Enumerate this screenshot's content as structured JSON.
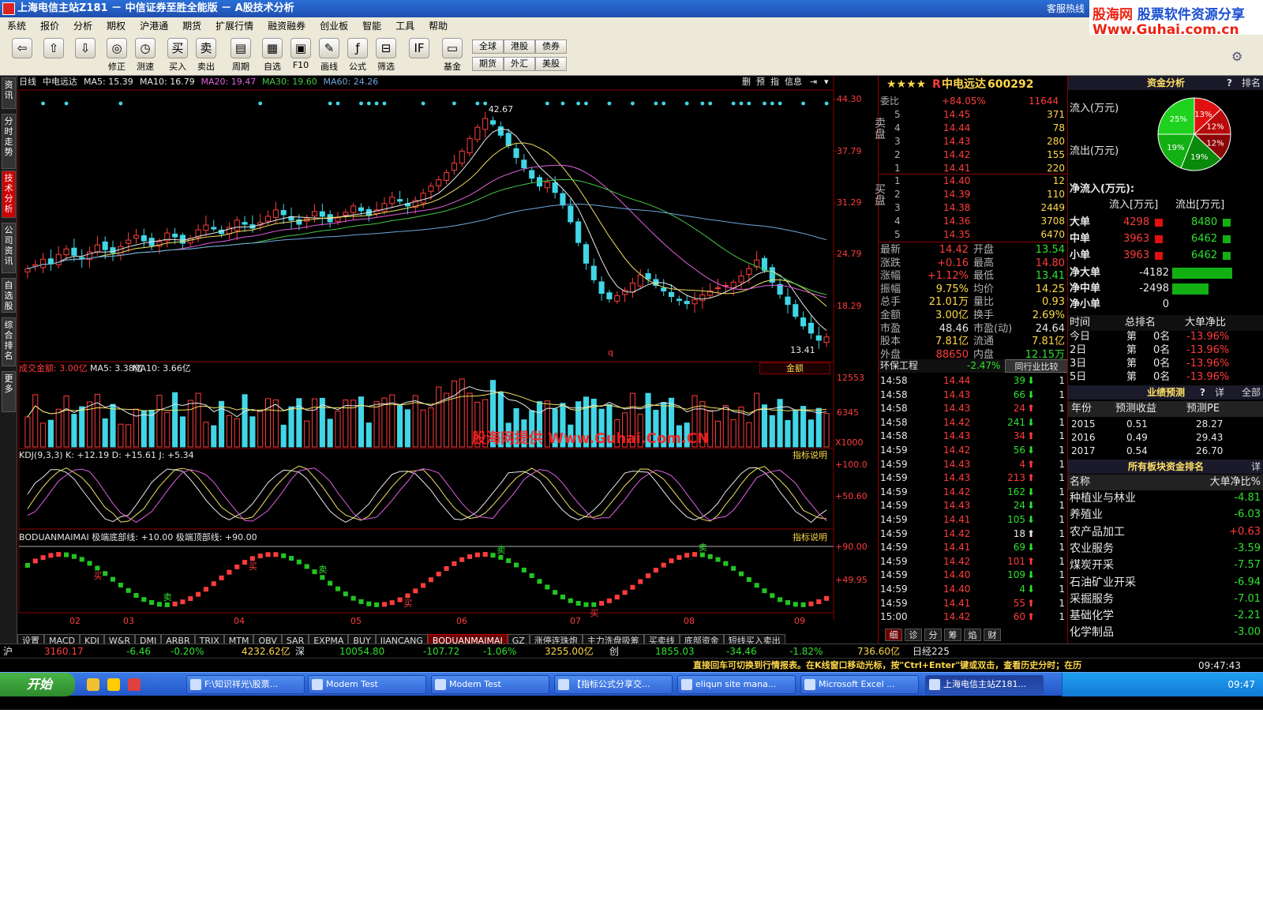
{
  "window": {
    "title": "上海电信主站Z181 － 中信证券至胜全能版 － A股技术分析",
    "hotline": "客服热线",
    "watermark": {
      "line1_blue": "股海网",
      "line1_rest": "股票软件资源分享",
      "line2": "Www.Guhai.com.cn"
    }
  },
  "menu": [
    "系统",
    "报价",
    "分析",
    "期权",
    "沪港通",
    "期货",
    "扩展行情",
    "融资融券",
    "创业板",
    "智能",
    "工具",
    "帮助"
  ],
  "toolbar": {
    "buttons": [
      {
        "label": "",
        "icon": "arrow-left-icon",
        "glyph": "⇦"
      },
      {
        "label": "",
        "icon": "arrow-up-icon",
        "glyph": "⇧"
      },
      {
        "label": "",
        "icon": "arrow-down-icon",
        "glyph": "⇩"
      },
      {
        "label": "修正",
        "icon": "fix-icon",
        "glyph": "◎"
      },
      {
        "label": "测速",
        "icon": "clock-icon",
        "glyph": "◷"
      },
      {
        "label": "买入",
        "icon": "buy-icon",
        "glyph": "买"
      },
      {
        "label": "卖出",
        "icon": "sell-icon",
        "glyph": "卖"
      },
      {
        "label": "周期",
        "icon": "period-icon",
        "glyph": "▤"
      },
      {
        "label": "自选",
        "icon": "watchlist-icon",
        "glyph": "▦"
      },
      {
        "label": "F10",
        "icon": "f10-icon",
        "glyph": "▣"
      },
      {
        "label": "画线",
        "icon": "draw-icon",
        "glyph": "✎"
      },
      {
        "label": "公式",
        "icon": "formula-icon",
        "glyph": "ƒ"
      },
      {
        "label": "筛选",
        "icon": "filter-icon",
        "glyph": "⊟"
      },
      {
        "label": "",
        "icon": "if-icon",
        "glyph": "IF"
      },
      {
        "label": "基金",
        "icon": "fund-icon",
        "glyph": "▭"
      }
    ],
    "small": [
      "全球",
      "港股",
      "债券",
      "期货",
      "外汇",
      "美股"
    ]
  },
  "left_tabs": [
    {
      "label": "资讯"
    },
    {
      "label": "分时走势"
    },
    {
      "label": "技术分析",
      "active": true
    },
    {
      "label": "公司资讯"
    },
    {
      "label": "自选股"
    },
    {
      "label": "综合排名"
    },
    {
      "label": "更多"
    }
  ],
  "kline": {
    "period": "日线",
    "name": "中电远达",
    "ma": [
      {
        "label": "MA5: 15.39",
        "color": "#e8e8e8"
      },
      {
        "label": "MA10: 16.79",
        "color": "#e8e8e8"
      },
      {
        "label": "MA20: 19.47",
        "color": "#e060e0"
      },
      {
        "label": "MA30: 19.60",
        "color": "#46c646"
      },
      {
        "label": "MA60: 24.26",
        "color": "#6fa8dc"
      }
    ],
    "top_buttons": [
      "删",
      "预",
      "指",
      "信息"
    ],
    "y_labels": [
      "44.30",
      "37.79",
      "31.29",
      "24.79",
      "18.29"
    ],
    "high_label": "42.67",
    "low_label": "13.41",
    "x_labels": [
      "02",
      "03",
      "04",
      "05",
      "06",
      "07",
      "08",
      "09"
    ],
    "q_marker": "q",
    "close": [
      23.0,
      23.5,
      24.2,
      23.6,
      24.8,
      25.5,
      24.7,
      24.3,
      25.1,
      26.0,
      25.4,
      25.0,
      25.8,
      26.6,
      27.2,
      26.5,
      25.9,
      26.4,
      27.5,
      27.0,
      26.2,
      26.8,
      27.9,
      28.5,
      28.0,
      27.4,
      28.2,
      29.1,
      28.6,
      28.1,
      28.8,
      29.6,
      30.4,
      29.8,
      29.1,
      28.6,
      29.3,
      30.2,
      29.6,
      28.9,
      29.4,
      30.1,
      30.9,
      30.3,
      29.7,
      30.4,
      31.2,
      32.0,
      31.5,
      30.9,
      31.6,
      32.5,
      33.4,
      34.2,
      35.1,
      36.3,
      37.8,
      39.4,
      40.8,
      41.9,
      41.2,
      39.8,
      38.5,
      37.0,
      35.7,
      34.4,
      33.4,
      33.9,
      32.6,
      31.0,
      28.9,
      26.3,
      23.7,
      21.6,
      19.9,
      19.2,
      19.6,
      20.3,
      21.2,
      22.2,
      21.7,
      20.9,
      20.2,
      19.5,
      19.0,
      18.6,
      19.1,
      19.7,
      20.2,
      20.6,
      20.9,
      21.3,
      22.1,
      23.0,
      24.1,
      22.8,
      21.3,
      19.8,
      18.5,
      17.0,
      15.8,
      14.9,
      14.0,
      14.42
    ],
    "sub1": {
      "title": "成交金额: 3.00亿",
      "ma": [
        "MA5: 3.38亿",
        "MA10: 3.66亿"
      ],
      "dropdown": "金额",
      "y_labels": [
        "12553",
        "6345"
      ],
      "unit": "X1000",
      "watermark": "股海网提供 Www.Guhai.Com.CN"
    },
    "sub2": {
      "title": "KDJ(9,3,3) K: +12.19 D: +15.61 J: +5.34",
      "help": "指标说明",
      "y_labels": [
        "+100.0",
        "+50.60"
      ]
    },
    "sub3": {
      "title": "BODUANMAIMAI 极端底部线: +10.00 极端顶部线: +90.00",
      "help": "指标说明",
      "y_labels": [
        "+90.00",
        "+49.95"
      ],
      "buy": "买",
      "sell": "卖"
    }
  },
  "bottom_tabs": [
    {
      "label": "设置"
    },
    {
      "label": "MACD"
    },
    {
      "label": "KDJ"
    },
    {
      "label": "W&R"
    },
    {
      "label": "DMI"
    },
    {
      "label": "ARBR"
    },
    {
      "label": "TRIX"
    },
    {
      "label": "MTM"
    },
    {
      "label": "OBV"
    },
    {
      "label": "SAR"
    },
    {
      "label": "EXPMA"
    },
    {
      "label": "BUY"
    },
    {
      "label": "JIANCANG"
    },
    {
      "label": "BODUANMAIMAI",
      "active": true
    },
    {
      "label": "GZ"
    },
    {
      "label": "涨停连珠炮"
    },
    {
      "label": "主力洗盘吸筹"
    },
    {
      "label": "买卖线"
    },
    {
      "label": "底部资金"
    },
    {
      "label": "短线买入卖出"
    }
  ],
  "quote": {
    "stars": "★★★★",
    "r_badge": "R",
    "name": "中电远达",
    "code": "600292",
    "weibi_label": "委比",
    "weibi": "+84.05%",
    "weicha": "11644",
    "sell_label": "卖盘",
    "buy_label": "买盘",
    "asks": [
      {
        "n": "5",
        "p": "14.45",
        "v": "371"
      },
      {
        "n": "4",
        "p": "14.44",
        "v": "78"
      },
      {
        "n": "3",
        "p": "14.43",
        "v": "280"
      },
      {
        "n": "2",
        "p": "14.42",
        "v": "155"
      },
      {
        "n": "1",
        "p": "14.41",
        "v": "220"
      }
    ],
    "bids": [
      {
        "n": "1",
        "p": "14.40",
        "v": "12"
      },
      {
        "n": "2",
        "p": "14.39",
        "v": "110"
      },
      {
        "n": "3",
        "p": "14.38",
        "v": "2449"
      },
      {
        "n": "4",
        "p": "14.36",
        "v": "3708"
      },
      {
        "n": "5",
        "p": "14.35",
        "v": "6470"
      }
    ],
    "stats": [
      {
        "l1": "最新",
        "v1": "14.42",
        "c1": "red",
        "l2": "开盘",
        "v2": "13.54",
        "c2": "grn"
      },
      {
        "l1": "涨跌",
        "v1": "+0.16",
        "c1": "red",
        "l2": "最高",
        "v2": "14.80",
        "c2": "red"
      },
      {
        "l1": "涨幅",
        "v1": "+1.12%",
        "c1": "red",
        "l2": "最低",
        "v2": "13.41",
        "c2": "grn"
      },
      {
        "l1": "振幅",
        "v1": "9.75%",
        "c1": "yel",
        "l2": "均价",
        "v2": "14.25",
        "c2": "yel"
      },
      {
        "l1": "总手",
        "v1": "21.01万",
        "c1": "yel",
        "l2": "量比",
        "v2": "0.93",
        "c2": "yel"
      },
      {
        "l1": "金额",
        "v1": "3.00亿",
        "c1": "yel",
        "l2": "换手",
        "v2": "2.69%",
        "c2": "yel"
      },
      {
        "l1": "市盈",
        "v1": "48.46",
        "c1": "wht",
        "l2": "市盈(动)",
        "v2": "24.64",
        "c2": "wht"
      },
      {
        "l1": "股本",
        "v1": "7.81亿",
        "c1": "yel",
        "l2": "流通",
        "v2": "7.81亿",
        "c2": "yel"
      },
      {
        "l1": "外盘",
        "v1": "88650",
        "c1": "red",
        "l2": "内盘",
        "v2": "12.15万",
        "c2": "grn"
      }
    ],
    "sector": "环保工程",
    "sector_change": "-2.47%",
    "compare_btn": "同行业比较",
    "ticks": [
      {
        "t": "14:58",
        "p": "14.44",
        "v": "39",
        "d": "down",
        "n": "1"
      },
      {
        "t": "14:58",
        "p": "14.43",
        "v": "66",
        "d": "down",
        "n": "1"
      },
      {
        "t": "14:58",
        "p": "14.43",
        "v": "24",
        "d": "up",
        "n": "1"
      },
      {
        "t": "14:58",
        "p": "14.42",
        "v": "241",
        "d": "down",
        "n": "1"
      },
      {
        "t": "14:58",
        "p": "14.43",
        "v": "34",
        "d": "up",
        "n": "1"
      },
      {
        "t": "14:59",
        "p": "14.42",
        "v": "56",
        "d": "down",
        "n": "1"
      },
      {
        "t": "14:59",
        "p": "14.43",
        "v": "4",
        "d": "up",
        "n": "1"
      },
      {
        "t": "14:59",
        "p": "14.43",
        "v": "213",
        "d": "up",
        "n": "1"
      },
      {
        "t": "14:59",
        "p": "14.42",
        "v": "162",
        "d": "down",
        "n": "1"
      },
      {
        "t": "14:59",
        "p": "14.43",
        "v": "24",
        "d": "down",
        "n": "1"
      },
      {
        "t": "14:59",
        "p": "14.41",
        "v": "105",
        "d": "down",
        "n": "1"
      },
      {
        "t": "14:59",
        "p": "14.42",
        "v": "18",
        "d": "flat",
        "n": "1"
      },
      {
        "t": "14:59",
        "p": "14.41",
        "v": "69",
        "d": "down",
        "n": "1"
      },
      {
        "t": "14:59",
        "p": "14.42",
        "v": "101",
        "d": "up",
        "n": "1"
      },
      {
        "t": "14:59",
        "p": "14.40",
        "v": "109",
        "d": "down",
        "n": "1"
      },
      {
        "t": "14:59",
        "p": "14.40",
        "v": "4",
        "d": "down",
        "n": "1"
      },
      {
        "t": "14:59",
        "p": "14.41",
        "v": "55",
        "d": "up",
        "n": "1"
      },
      {
        "t": "15:00",
        "p": "14.42",
        "v": "60",
        "d": "up",
        "n": "1"
      }
    ],
    "bottom_tabs": [
      "细",
      "诊",
      "分",
      "筹",
      "焰",
      "财"
    ]
  },
  "fund": {
    "title": "资金分析",
    "q": "?",
    "rank": "排名",
    "inflow_label": "流入(万元)",
    "outflow_label": "流出(万元)",
    "pie": [
      {
        "label": "13%",
        "value": 13,
        "color": "#e01010"
      },
      {
        "label": "12%",
        "value": 12,
        "color": "#b80a0a"
      },
      {
        "label": "12%",
        "value": 12,
        "color": "#8c0606"
      },
      {
        "label": "19%",
        "value": 19,
        "color": "#0a8a0a"
      },
      {
        "label": "19%",
        "value": 19,
        "color": "#12b012"
      },
      {
        "label": "25%",
        "value": 25,
        "color": "#1ed21e"
      }
    ],
    "net_label": "净流入(万元):",
    "cols": [
      "流入[万元]",
      "流出[万元]"
    ],
    "flows": [
      {
        "name": "大单",
        "in": "4298",
        "out": "8480"
      },
      {
        "name": "中单",
        "in": "3963",
        "out": "6462"
      },
      {
        "name": "小单",
        "in": "3963",
        "out": "6462"
      }
    ],
    "nets": [
      {
        "name": "净大单",
        "v": "-4182",
        "bar": 100
      },
      {
        "name": "净中单",
        "v": "-2498",
        "bar": 60
      },
      {
        "name": "净小单",
        "v": "0",
        "bar": 0
      }
    ],
    "rank_cols": [
      "时间",
      "总排名",
      "大单净比"
    ],
    "ranks": [
      {
        "t": "今日",
        "di": "第",
        "n": "0名",
        "v": "-13.96%"
      },
      {
        "t": "2日",
        "di": "第",
        "n": "0名",
        "v": "-13.96%"
      },
      {
        "t": "3日",
        "di": "第",
        "n": "0名",
        "v": "-13.96%"
      },
      {
        "t": "5日",
        "di": "第",
        "n": "0名",
        "v": "-13.96%"
      }
    ],
    "forecast_title": "业绩预测",
    "forecast_q": "?",
    "forecast_d": "详",
    "forecast_all": "全部",
    "forecast_cols": [
      "年份",
      "预测收益",
      "预测PE"
    ],
    "forecast": [
      {
        "y": "2015",
        "e": "0.51",
        "pe": "28.27"
      },
      {
        "y": "2016",
        "e": "0.49",
        "pe": "29.43"
      },
      {
        "y": "2017",
        "e": "0.54",
        "pe": "26.70"
      }
    ],
    "sector_title": "所有板块资金排名",
    "sector_d": "详",
    "sector_cols": [
      "名称",
      "大单净比%"
    ],
    "sectors": [
      {
        "n": "种植业与林业",
        "v": "-4.81",
        "c": "grn"
      },
      {
        "n": "养殖业",
        "v": "-6.03",
        "c": "grn"
      },
      {
        "n": "农产品加工",
        "v": "+0.63",
        "c": "red"
      },
      {
        "n": "农业服务",
        "v": "-3.59",
        "c": "grn"
      },
      {
        "n": "煤炭开采",
        "v": "-7.57",
        "c": "grn"
      },
      {
        "n": "石油矿业开采",
        "v": "-6.94",
        "c": "grn"
      },
      {
        "n": "采掘服务",
        "v": "-7.01",
        "c": "grn"
      },
      {
        "n": "基础化学",
        "v": "-2.21",
        "c": "grn"
      },
      {
        "n": "化学制品",
        "v": "-3.00",
        "c": "grn"
      }
    ]
  },
  "status": {
    "sh_label": "沪",
    "sh_idx": "3160.17",
    "sh_chg": "-6.46",
    "sh_pct": "-0.20%",
    "sh_amt": "4232.62亿",
    "sz_label": "深",
    "sz_idx": "10054.80",
    "sz_chg": "-107.72",
    "sz_pct": "-1.06%",
    "sz_amt": "3255.00亿",
    "cy_label": "创",
    "cy_idx": "1855.03",
    "cy_chg": "-34.46",
    "cy_pct": "-1.82%",
    "cy_amt": "736.60亿",
    "rj_label": "日经225",
    "ticker": "直接回车可切换到行情报表。在K线窗口移动光标，按\"Ctrl+Enter\"键或双击，查看历史分时；在历",
    "time": "09:47:43"
  },
  "taskbar": {
    "start": "开始",
    "tasks": [
      {
        "label": "F:\\知识祥光\\股票..."
      },
      {
        "label": "Modem Test"
      },
      {
        "label": "Modem Test"
      },
      {
        "label": "【指标公式分享交..."
      },
      {
        "label": "eliqun site mana..."
      },
      {
        "label": "Microsoft Excel ..."
      },
      {
        "label": "上海电信主站Z181...",
        "active": true
      }
    ],
    "clock": "09:47"
  },
  "colors": {
    "up": "#ff3c3c",
    "down": "#41d6e6",
    "grid": "#8a0000",
    "ma5": "#e8e8e8",
    "ma10": "#f0e060",
    "ma20": "#e060e0",
    "ma30": "#46c646",
    "ma60": "#6fa8dc"
  }
}
